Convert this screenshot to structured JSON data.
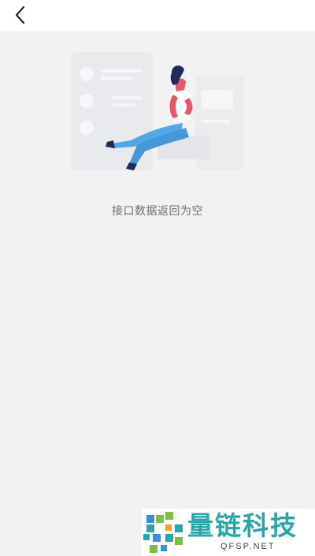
{
  "navbar": {
    "back_icon": "chevron-left-icon"
  },
  "empty_state": {
    "illustration": "person-sitting-with-empty-list-illustration",
    "message": "接口数据返回为空"
  },
  "watermark": {
    "logo_icon": "qfsp-pixel-logo",
    "title": "量链科技",
    "subtitle": "QFSP.NET",
    "colors": {
      "teal": "#2aa6ab",
      "orange": "#f1a33a",
      "green": "#7cc043",
      "blue": "#3a8fd6"
    }
  }
}
